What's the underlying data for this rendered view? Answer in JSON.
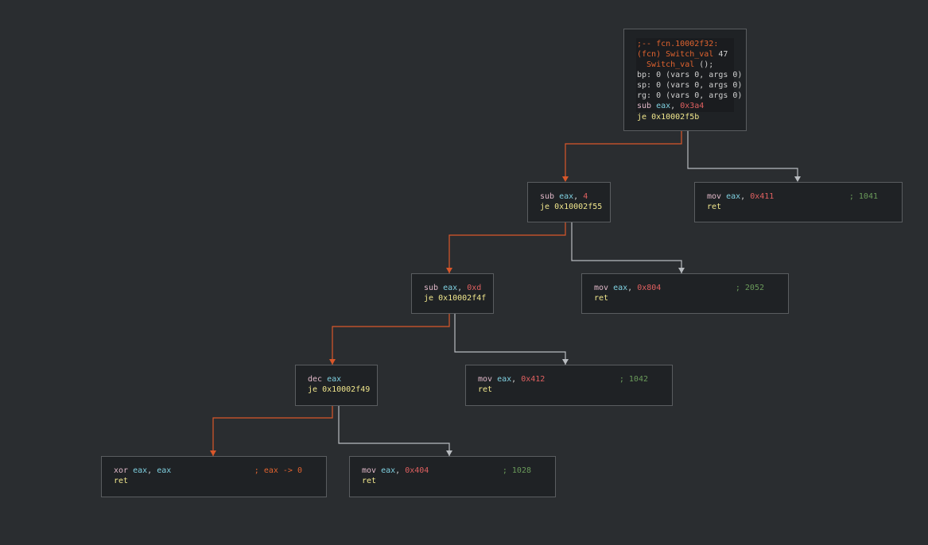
{
  "colors": {
    "true_edge": "#d9572a",
    "false_edge": "#b8bcc0",
    "node_border": "#5a5d60",
    "node_bg": "#1f2225",
    "background": "#2a2d30"
  },
  "nodes": {
    "entry": {
      "label_line": ";-- fcn.10002f32:",
      "fcn_prefix": "(fcn) ",
      "fcn_name": "Switch_val",
      "fcn_size": " 47",
      "sig_name": "  Switch_val",
      "sig_rest": " ();",
      "bp": "bp: 0 (vars 0, args 0)",
      "sp": "sp: 0 (vars 0, args 0)",
      "rg": "rg: 0 (vars 0, args 0)",
      "ins1": {
        "mnem": "sub ",
        "reg": "eax",
        "sep": ", ",
        "imm": "0x3a4"
      },
      "ins2": {
        "mnem": "je ",
        "target": "0x10002f5b"
      }
    },
    "b1": {
      "ins1": {
        "mnem": "sub ",
        "reg": "eax",
        "sep": ", ",
        "imm": "4"
      },
      "ins2": {
        "mnem": "je ",
        "target": "0x10002f55"
      }
    },
    "r1041": {
      "ins1": {
        "mnem": "mov ",
        "reg": "eax",
        "sep": ", ",
        "imm": "0x411",
        "comment": "; 1041"
      },
      "ins2": {
        "mnem": "ret"
      }
    },
    "b2": {
      "ins1": {
        "mnem": "sub ",
        "reg": "eax",
        "sep": ", ",
        "imm": "0xd"
      },
      "ins2": {
        "mnem": "je ",
        "target": "0x10002f4f"
      }
    },
    "r2052": {
      "ins1": {
        "mnem": "mov ",
        "reg": "eax",
        "sep": ", ",
        "imm": "0x804",
        "comment": "; 2052"
      },
      "ins2": {
        "mnem": "ret"
      }
    },
    "b3": {
      "ins1": {
        "mnem": "dec ",
        "reg": "eax"
      },
      "ins2": {
        "mnem": "je ",
        "target": "0x10002f49"
      }
    },
    "r1042": {
      "ins1": {
        "mnem": "mov ",
        "reg": "eax",
        "sep": ", ",
        "imm": "0x412",
        "comment": "; 1042"
      },
      "ins2": {
        "mnem": "ret"
      }
    },
    "rzero": {
      "ins1": {
        "mnem": "xor ",
        "reg": "eax",
        "sep": ", ",
        "reg2": "eax",
        "comment": "; eax -> 0"
      },
      "ins2": {
        "mnem": "ret"
      }
    },
    "r1028": {
      "ins1": {
        "mnem": "mov ",
        "reg": "eax",
        "sep": ", ",
        "imm": "0x404",
        "comment": "; 1028"
      },
      "ins2": {
        "mnem": "ret"
      }
    }
  }
}
